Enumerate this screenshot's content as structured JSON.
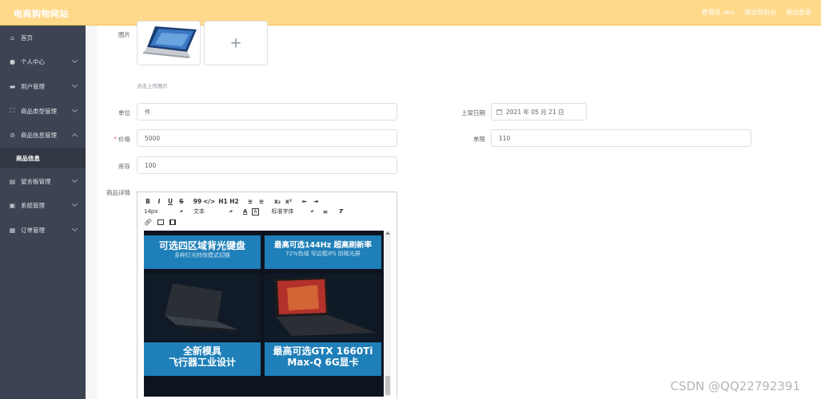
{
  "header": {
    "brand": "电商购物网站",
    "links": [
      "管理员 abo",
      "退出到前台",
      "退出登录"
    ]
  },
  "sidebar": {
    "items": [
      {
        "label": "首页",
        "icon": "home-icon",
        "has_arrow": false
      },
      {
        "label": "个人中心",
        "icon": "user-icon",
        "has_arrow": true
      },
      {
        "label": "用户管理",
        "icon": "user-manage-icon",
        "has_arrow": true
      },
      {
        "label": "商品类型管理",
        "icon": "category-icon",
        "has_arrow": true
      },
      {
        "label": "商品信息管理",
        "icon": "goods-icon",
        "has_arrow": true,
        "expanded": true
      },
      {
        "label": "留言板管理",
        "icon": "message-icon",
        "has_arrow": true
      },
      {
        "label": "系统管理",
        "icon": "settings-icon",
        "has_arrow": true
      },
      {
        "label": "订单管理",
        "icon": "order-icon",
        "has_arrow": true
      }
    ],
    "subitem": "商品信息"
  },
  "form": {
    "image_label": "图片",
    "upload_hint": "点击上传图片",
    "unit_label": "单位",
    "unit_value": "件",
    "listing_date_label": "上架日期",
    "listing_date_value": "2021 年 05 月 21 日",
    "price_label": "价格",
    "price_required": "*",
    "price_value": "5000",
    "sales_label": "单限",
    "sales_value": "110",
    "stock_label": "库存",
    "stock_value": "100",
    "detail_label": "商品详情"
  },
  "editor": {
    "toolbar_row1": [
      "B",
      "I",
      "U",
      "S",
      "99",
      "</>",
      "H1",
      "H2",
      "≡",
      "≡",
      "x₂",
      "x²",
      "⇤",
      "⇥"
    ],
    "font_size": "14px",
    "text_style": "文本",
    "font_family": "标准字体",
    "promo": [
      {
        "big": "可选四区域背光键盘",
        "small": "多种灯光特效模式切换"
      },
      {
        "big": "最高可选144Hz 超高刷新率",
        "small": "72%色域 窄边框IPS 防眩光屏"
      },
      {
        "big": "全新模具",
        "big2": "飞行器工业设计"
      },
      {
        "big": "最高可选GTX 1660Ti",
        "big2": "Max-Q 6G显卡"
      }
    ]
  },
  "watermark": "CSDN @QQ22792391",
  "colors": {
    "header_bg": "#ffd98a",
    "sidebar_bg": "#3c4352",
    "required": "#f56c6c",
    "promo_blue": "#1f7fb8"
  }
}
